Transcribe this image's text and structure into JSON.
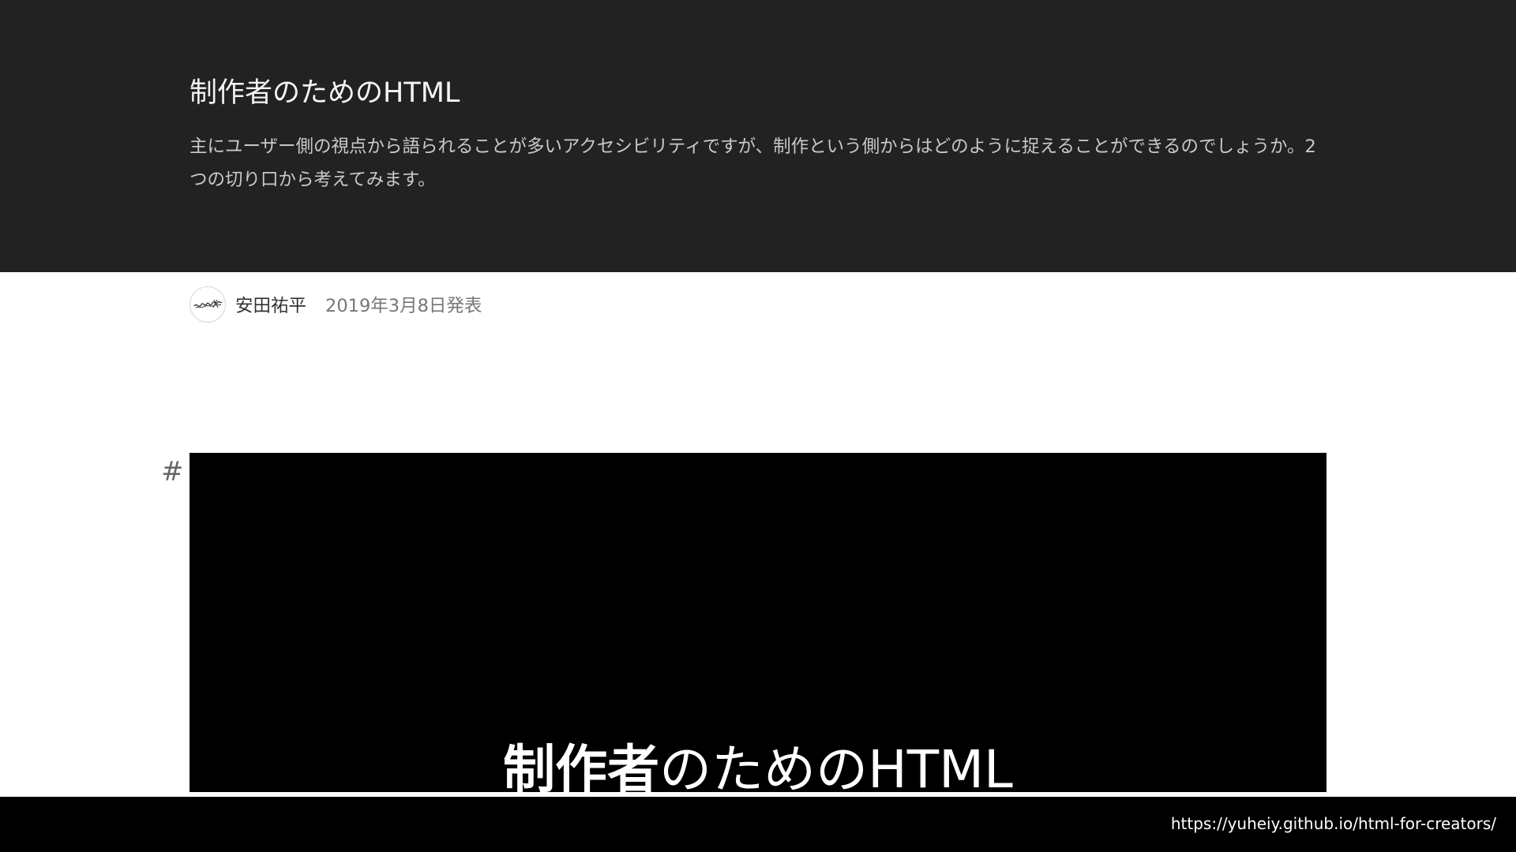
{
  "header": {
    "title": "制作者のためのHTML",
    "description": "主にユーザー側の視点から語られることが多いアクセシビリティですが、制作という側からはどのように捉えることができるのでしょうか。2つの切り口から考えてみます。"
  },
  "byline": {
    "author": "安田祐平",
    "date": "2019年3月8日発表",
    "avatar_icon": "signature-avatar-icon"
  },
  "section": {
    "anchor": "#"
  },
  "slide": {
    "title_strong": "制作者",
    "title_rest": "のためのHTML"
  },
  "footer": {
    "url": "https://yuheiy.github.io/html-for-creators/"
  },
  "colors": {
    "hero_bg": "#222222",
    "slide_bg": "#000000",
    "footer_bg": "#000000"
  }
}
